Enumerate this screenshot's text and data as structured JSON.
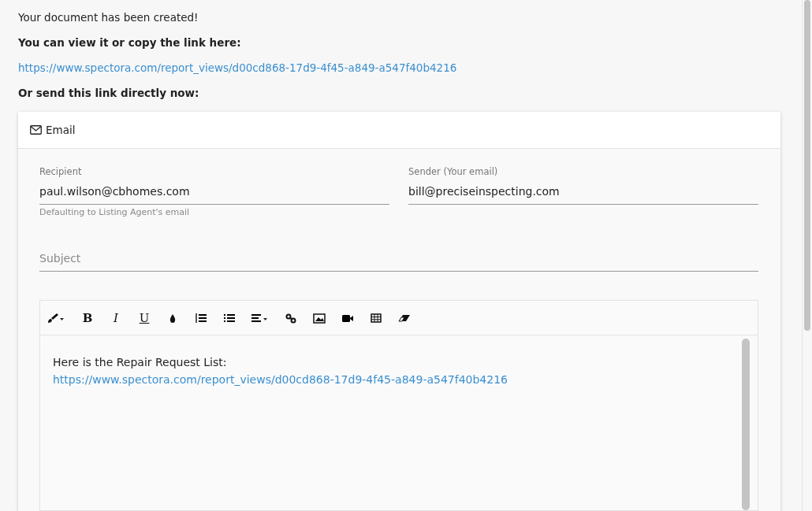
{
  "message": "Your document has been created!",
  "view_label": "You can view it or copy the link here:",
  "report_link": "https://www.spectora.com/report_views/d00cd868-17d9-4f45-a849-a547f40b4216",
  "send_label": "Or send this link directly now:",
  "email_panel": {
    "title": "Email",
    "recipient": {
      "label": "Recipient",
      "value": "paul.wilson@cbhomes.com",
      "hint": "Defaulting to Listing Agent's email"
    },
    "sender": {
      "label": "Sender (Your email)",
      "value": "bill@preciseinspecting.com"
    },
    "subject": {
      "placeholder": "Subject"
    },
    "toolbar": [
      {
        "kind": "brush"
      },
      {
        "kind": "bold",
        "label": "B"
      },
      {
        "kind": "italic",
        "label": "I"
      },
      {
        "kind": "underline",
        "label": "U"
      },
      {
        "kind": "drop"
      },
      {
        "kind": "ordered"
      },
      {
        "kind": "unordered"
      },
      {
        "kind": "align"
      },
      {
        "kind": "link"
      },
      {
        "kind": "image"
      },
      {
        "kind": "video"
      },
      {
        "kind": "table"
      },
      {
        "kind": "eraser"
      }
    ],
    "body_text": "Here is the Repair Request List:",
    "body_link": "https://www.spectora.com/report_views/d00cd868-17d9-4f45-a849-a547f40b4216"
  }
}
